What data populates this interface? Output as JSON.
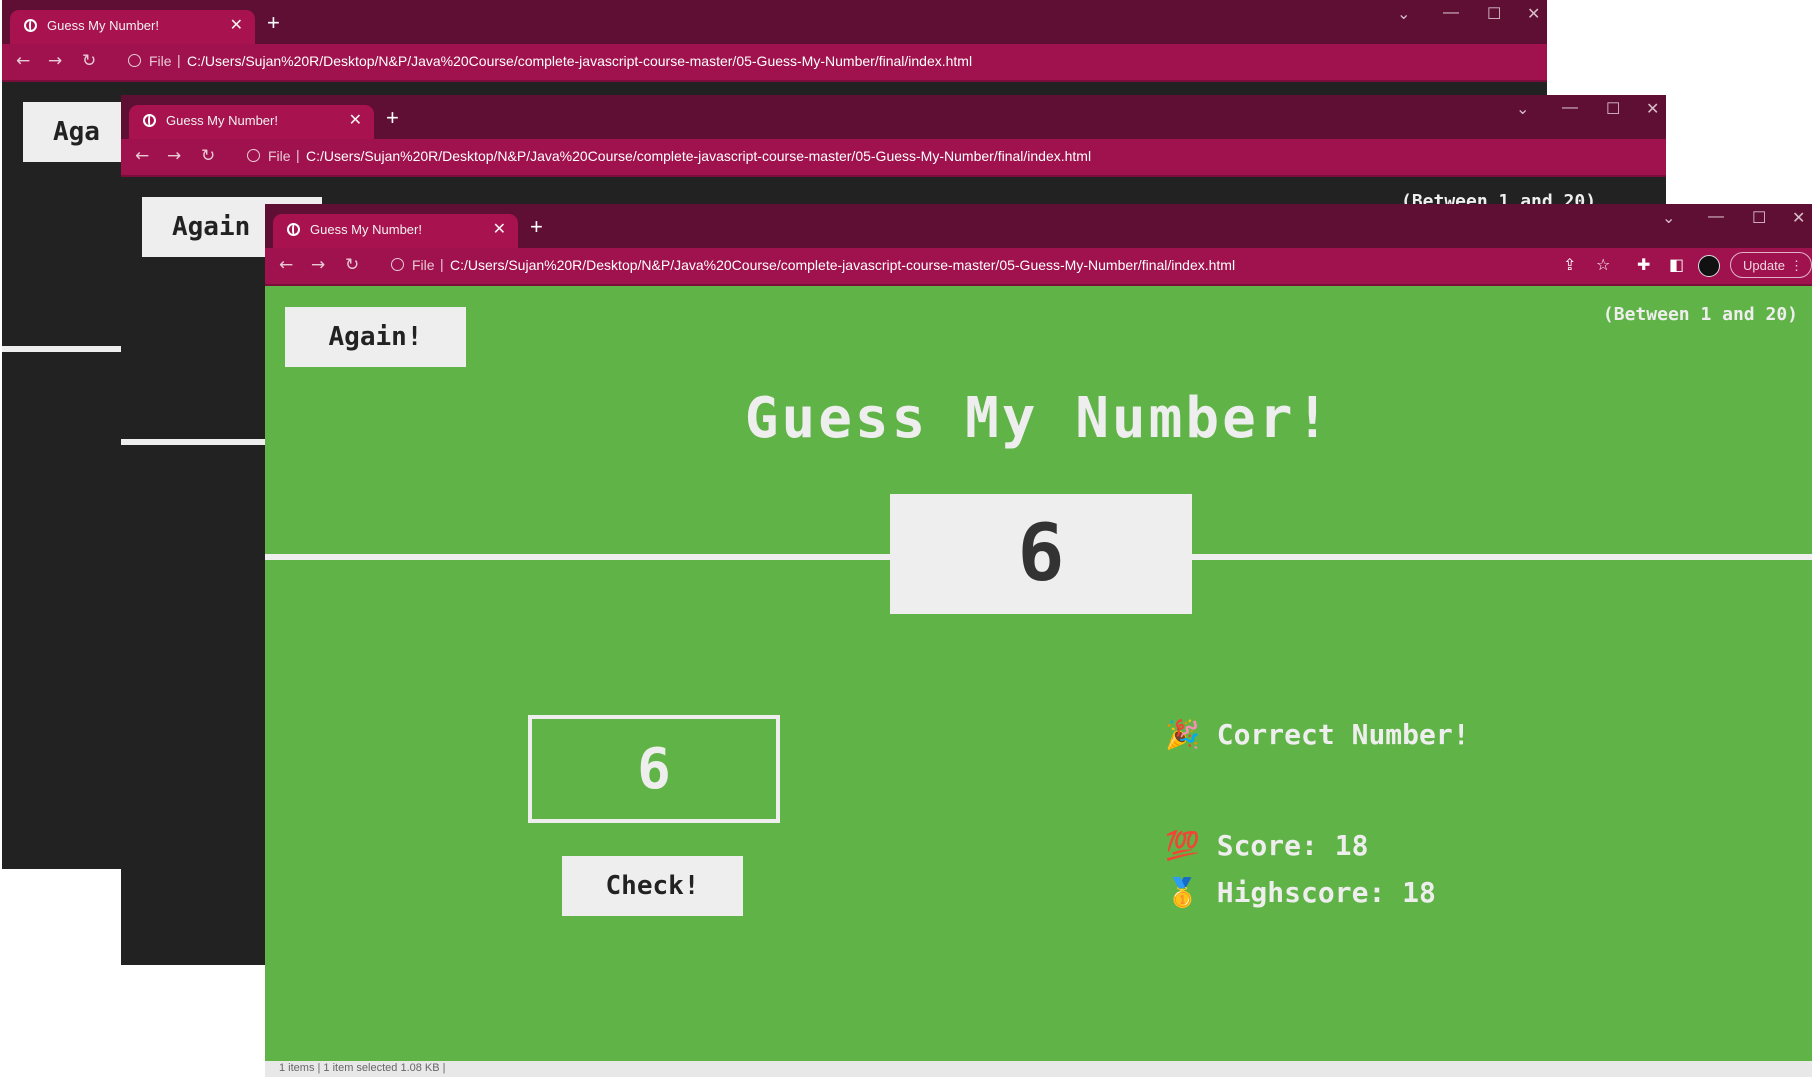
{
  "browser": {
    "tab_title": "Guess My Number!",
    "close_tab": "✕",
    "new_tab": "+",
    "file_label": "File",
    "url": "C:/Users/Sujan%20R/Desktop/N&P/Java%20Course/complete-javascript-course-master/05-Guess-My-Number/final/index.html",
    "update_label": "Update"
  },
  "game": {
    "again_label": "Again!",
    "between_label": "(Between 1 and 20)",
    "title": "Guess My Number!",
    "secret_number": "6",
    "guess_value": "6",
    "check_label": "Check!",
    "message": "🎉 Correct Number!",
    "score_label": "💯 Score:",
    "score_value": "18",
    "highscore_label": "🥇 Highscore:",
    "highscore_value": "18"
  },
  "back_windows": {
    "again_partial_1": "Aga",
    "again_partial_2": "Again",
    "between_partial": "(Between 1 and 20)"
  },
  "status": {
    "text": "1 items | 1 item selected 1.08 KB |"
  },
  "colors": {
    "titlebar": "#5f0f34",
    "tab": "#a8124f",
    "toolbar": "#a0124d",
    "game_win_bg": "#60b347",
    "game_default_bg": "#222222",
    "panel": "#eeeeee"
  }
}
